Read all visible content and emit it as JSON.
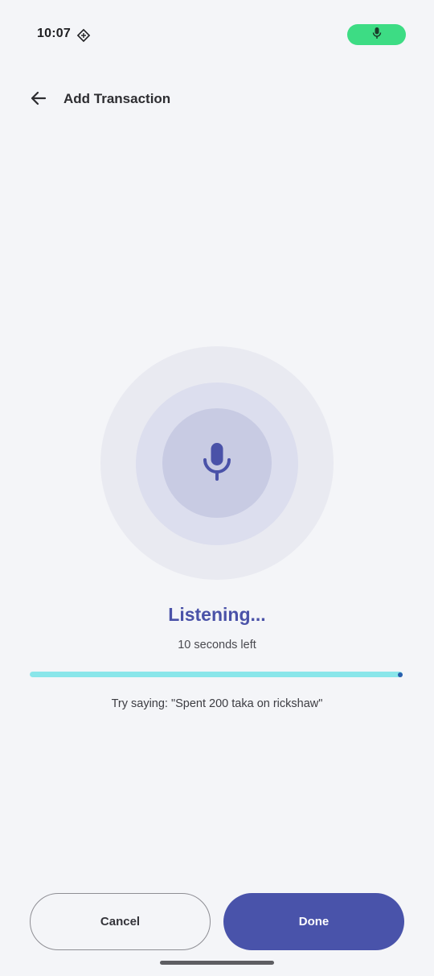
{
  "status_bar": {
    "time": "10:07",
    "indicator_icon": "data-saver-diamond-icon",
    "mic_pill_icon": "mic-icon",
    "mic_pill_color": "#3ddc84"
  },
  "app_bar": {
    "back_icon": "arrow-back-icon",
    "title": "Add Transaction"
  },
  "listening": {
    "mic_icon": "mic-icon",
    "title": "Listening...",
    "seconds_left": "10 seconds left",
    "progress_fraction": 1.0,
    "hint": "Try saying: \"Spent 200 taka on rickshaw\""
  },
  "actions": {
    "cancel_label": "Cancel",
    "done_label": "Done"
  },
  "colors": {
    "accent": "#4953aa",
    "progress": "#8ae6ea",
    "background": "#f4f5f8"
  }
}
